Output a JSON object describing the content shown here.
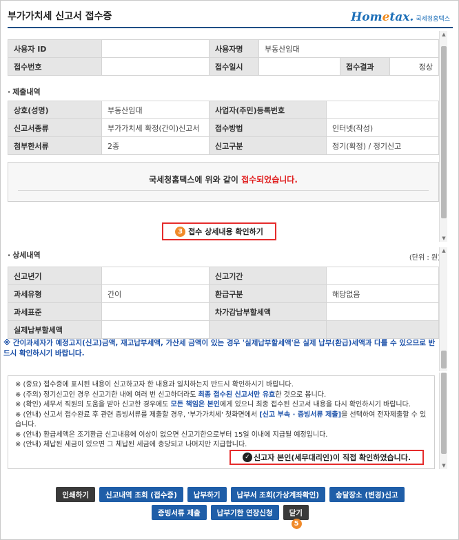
{
  "header": {
    "title": "부가가치세 신고서 접수증",
    "logo_main_pre": "Hom",
    "logo_main_e": "e",
    "logo_main_post": "tax.",
    "logo_sub": "국세청홈택스"
  },
  "receipt": {
    "user_id_label": "사용자 ID",
    "user_id_value": "",
    "user_name_label": "사용자명",
    "user_name_value": "부동산임대",
    "receipt_no_label": "접수번호",
    "receipt_no_value": "",
    "receipt_date_label": "접수일시",
    "receipt_date_value": "",
    "result_label": "접수결과",
    "result_value": "정상"
  },
  "submission": {
    "section_title": "제출내역",
    "company_label": "상호(성명)",
    "company_value": "부동산임대",
    "reg_no_label": "사업자(주민)등록번호",
    "reg_no_value": "",
    "form_type_label": "신고서종류",
    "form_type_value": "부가가치세 확정(간이)신고서",
    "method_label": "접수방법",
    "method_value": "인터넷(작성)",
    "attach_label": "첨부한서류",
    "attach_value": "2종",
    "filing_type_label": "신고구분",
    "filing_type_value": "정기(확정) / 정기신고"
  },
  "notice": {
    "prefix": "국세청홈택스에 위와 같이 ",
    "highlight": "접수되었습니다."
  },
  "confirm_button": {
    "badge": "3",
    "label": "접수 상세내용 확인하기"
  },
  "details": {
    "section_title": "상세내역",
    "unit": "(단위 : 원)",
    "period_year_label": "신고년기",
    "period_year_value": "",
    "period_label": "신고기간",
    "period_value": "",
    "tax_type_label": "과세유형",
    "tax_type_value": "간이",
    "refund_label": "환급구분",
    "refund_value": "해당없음",
    "tax_base_label": "과세표준",
    "tax_base_value": "",
    "deduct_label": "차가감납부할세액",
    "deduct_value": "",
    "actual_label": "실제납부할세액",
    "actual_value": ""
  },
  "warning": {
    "line": "※ 간이과세자가 예정고지(신고)금액, 재고납부세액, 가산세 금액이 있는 경우 '실제납부할세액'은 실제 납부(환급)세액과 다를 수 있으므로 반드시 확인하시기 바랍니다."
  },
  "info": {
    "l1": "※ (중요) 접수증에 표시된 내용이 신고하고자 한 내용과 일치하는지 반드시 확인하시기 바랍니다.",
    "l2a": "※ (주의) 정기신고인 경우 신고기한 내에 여러 번 신고하더라도 ",
    "l2b": "최종 접수된 신고서만 유효",
    "l2c": "한 것으로 봅니다.",
    "l3a": "※ (확인) 세무서 직원의 도움을 받아 신고한 경우에도 ",
    "l3b": "모든 책임은 본인",
    "l3c": "에게 있으니 최종 접수된 신고서 내용을 다시 확인하시기 바랍니다.",
    "l4a": "※ (안내) 신고서 접수완료 후 관련 증빙서류를 제출할 경우, '부가가치세' 첫화면에서 ",
    "l4b": "[신고 부속 · 증빙서류 제출]",
    "l4c": "을 선택하여 전자제출할 수 있습니다.",
    "l5": "※ (안내) 환급세액은 조기환급 신고내용에 이상이 없으면 신고기한으로부터 15일 이내에 지급될 예정입니다.",
    "l6": "※ (안내) 체납된 세금이 있으면 그 체납된 세금에 충당되고 나머지만 지급합니다."
  },
  "self_confirm": {
    "label": "신고자 본인(세무대리인)이 직접 확인하였습니다."
  },
  "buttons": {
    "print": "인쇄하기",
    "history": "신고내역 조회 (접수증)",
    "pay": "납부하기",
    "pay_lookup": "납부서 조회(가상계좌확인)",
    "office_change": "송달장소 (변경)신고",
    "evidence": "증빙서류 제출",
    "extend": "납부기한 연장신청",
    "close": "닫기",
    "close_badge": "5"
  }
}
